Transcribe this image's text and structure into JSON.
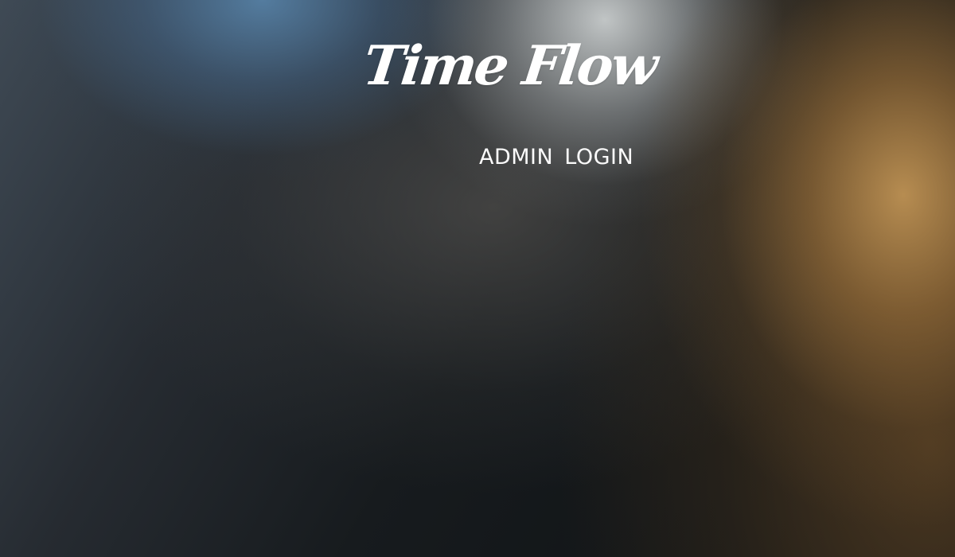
{
  "app": {
    "name": "Time Flow"
  },
  "login": {
    "title": "ADMIN LOGIN"
  },
  "colors": {
    "text": "#ffffff",
    "dark_background": "#101316",
    "blue_glow": "#5884aa",
    "warm_glow": "#be9254",
    "light_glow": "#e4e8e8"
  }
}
